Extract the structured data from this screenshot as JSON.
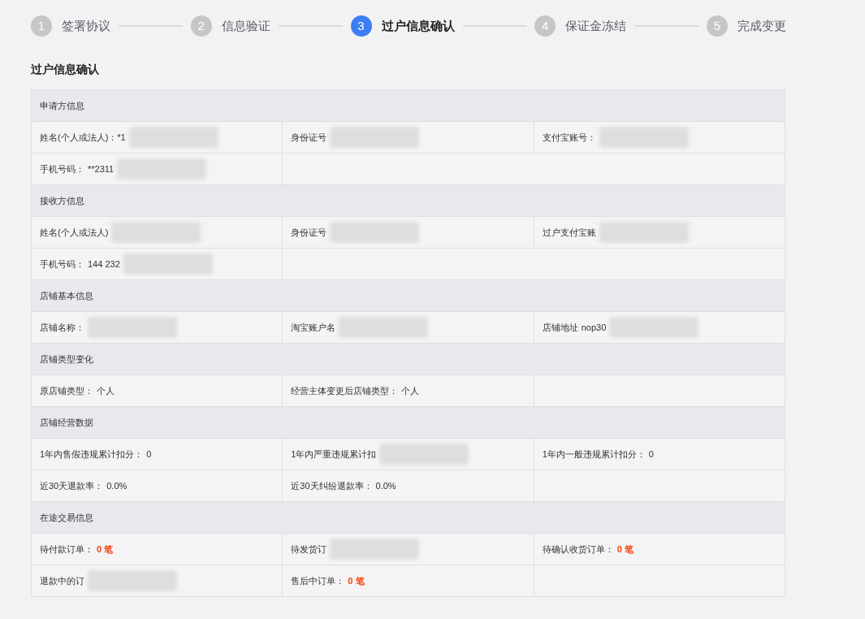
{
  "steps": [
    {
      "number": "1",
      "label": "签署协议",
      "selected": false
    },
    {
      "number": "2",
      "label": "信息验证",
      "selected": false
    },
    {
      "number": "3",
      "label": "过户信息确认",
      "selected": true
    },
    {
      "number": "4",
      "label": "保证金冻结",
      "selected": false
    },
    {
      "number": "5",
      "label": "完成变更",
      "selected": false
    }
  ],
  "title": "过户信息确认",
  "sections": [
    {
      "heading": "申请方信息",
      "rows": [
        [
          {
            "label": "姓名(个人或法人)：*1",
            "redacted": true
          },
          {
            "label": "身份证号",
            "redacted": true
          },
          {
            "label": "支付宝账号：",
            "redacted": true
          }
        ],
        [
          {
            "label": "手机号码：",
            "value": "**2311",
            "redacted": true
          }
        ]
      ]
    },
    {
      "heading": "接收方信息",
      "rows": [
        [
          {
            "label": "姓名(个人或法人)",
            "redacted": true
          },
          {
            "label": "身份证号",
            "redacted": true
          },
          {
            "label": "过户支付宝账",
            "redacted": true
          }
        ],
        [
          {
            "label": "手机号码：",
            "value": "144 232",
            "redacted": true
          }
        ]
      ]
    },
    {
      "heading": "店铺基本信息",
      "rows": [
        [
          {
            "label": "店铺名称：",
            "redacted": true
          },
          {
            "label": "淘宝账户名",
            "redacted": true
          },
          {
            "label": "店铺地址",
            "value": "nop30",
            "redacted": true
          }
        ]
      ]
    },
    {
      "heading": "店铺类型变化",
      "rows": [
        [
          {
            "label": "原店铺类型：",
            "value": "个人"
          },
          {
            "label": "经营主体变更后店铺类型：",
            "value": "个人"
          }
        ]
      ]
    },
    {
      "heading": "店铺经营数据",
      "rows": [
        [
          {
            "label": "1年内售假违规累计扣分：",
            "value": "0"
          },
          {
            "label": "1年内严重违规累计扣",
            "redacted": true
          },
          {
            "label": "1年内一般违规累计扣分：",
            "value": "0"
          }
        ],
        [
          {
            "label": "近30天退款率：",
            "value": "0.0%"
          },
          {
            "label": "近30天纠纷退款率：",
            "value": "0.0%"
          }
        ]
      ]
    },
    {
      "heading": "在途交易信息",
      "rows": [
        [
          {
            "label": "待付款订单：",
            "value": "0 笔",
            "highlight": true
          },
          {
            "label": "待发货订",
            "redacted": true
          },
          {
            "label": "待确认收货订单：",
            "value": "0 笔",
            "highlight": true
          }
        ],
        [
          {
            "label": "退款中的订",
            "redacted": true
          },
          {
            "label": "售后中订单：",
            "value": "0 笔",
            "highlight": true
          }
        ]
      ]
    }
  ]
}
